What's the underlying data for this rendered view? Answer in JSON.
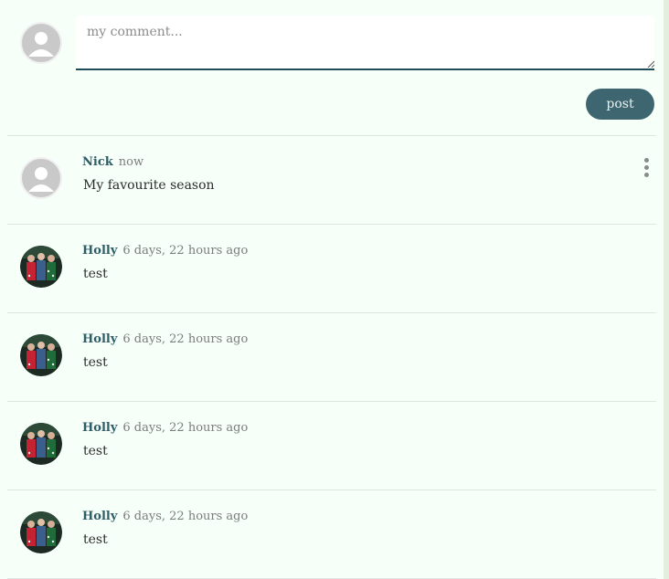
{
  "composer": {
    "placeholder": "my comment...",
    "post_label": "post",
    "avatar_icon": "default-user-avatar-icon"
  },
  "comments": [
    {
      "author": "Nick",
      "time": "now",
      "text": "My favourite season",
      "avatar": "default-user-avatar-icon",
      "has_menu": true
    },
    {
      "author": "Holly",
      "time": "6 days, 22 hours ago",
      "text": "test",
      "avatar": "group-photo-avatar"
    },
    {
      "author": "Holly",
      "time": "6 days, 22 hours ago",
      "text": "test",
      "avatar": "group-photo-avatar"
    },
    {
      "author": "Holly",
      "time": "6 days, 22 hours ago",
      "text": "test",
      "avatar": "group-photo-avatar"
    },
    {
      "author": "Holly",
      "time": "6 days, 22 hours ago",
      "text": "test",
      "avatar": "group-photo-avatar"
    }
  ],
  "colors": {
    "background": "#f6fff8",
    "accent": "#3e6670",
    "author": "#2f5d67"
  }
}
